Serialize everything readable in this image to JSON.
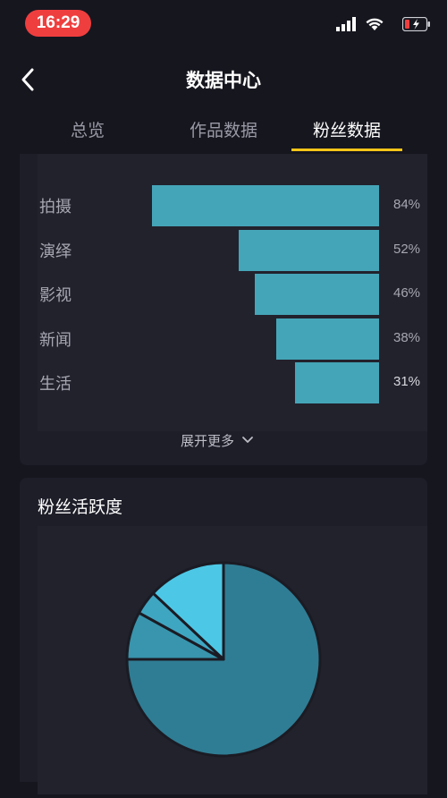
{
  "status_bar": {
    "time": "16:29"
  },
  "nav": {
    "title": "数据中心"
  },
  "tabs": [
    {
      "label": "总览",
      "active": false
    },
    {
      "label": "作品数据",
      "active": false
    },
    {
      "label": "粉丝数据",
      "active": true
    }
  ],
  "interest_chart": {
    "expand_label": "展开更多"
  },
  "activity": {
    "title": "粉丝活跃度"
  },
  "chart_data": [
    {
      "type": "bar",
      "orientation": "horizontal",
      "categories": [
        "拍摄",
        "演绎",
        "影视",
        "新闻",
        "生活"
      ],
      "values": [
        84,
        52,
        46,
        38,
        31
      ],
      "value_labels": [
        "84%",
        "52%",
        "46%",
        "38%",
        "31%"
      ],
      "bar_color": "#45a5b8"
    },
    {
      "type": "pie",
      "values": [
        75,
        8,
        4,
        13
      ],
      "colors": [
        "#2f7d94",
        "#3895ad",
        "#3fa6c2",
        "#4cc8e6"
      ],
      "border_color": "#1b1b24"
    }
  ]
}
